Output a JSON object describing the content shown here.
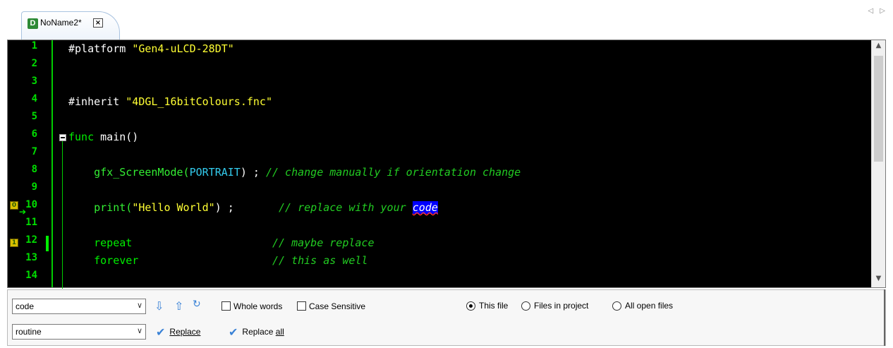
{
  "tab": {
    "icon_letter": "D",
    "title": "NoName2*",
    "close_glyph": "×",
    "scroll_glyphs": "◁ ▷"
  },
  "editor": {
    "lines": [
      {
        "num": "1",
        "parts": [
          [
            "pl",
            "#platform "
          ],
          [
            "str",
            "\"Gen4-uLCD-28DT\""
          ]
        ]
      },
      {
        "num": "2",
        "parts": []
      },
      {
        "num": "3",
        "parts": []
      },
      {
        "num": "4",
        "parts": [
          [
            "pl",
            "#inherit "
          ],
          [
            "str",
            "\"4DGL_16bitColours.fnc\""
          ]
        ]
      },
      {
        "num": "5",
        "parts": []
      },
      {
        "num": "6",
        "parts": [
          [
            "kw",
            "func "
          ],
          [
            "pl",
            "main()"
          ]
        ]
      },
      {
        "num": "7",
        "parts": []
      },
      {
        "num": "8",
        "parts": [
          [
            "fn",
            "    gfx_ScreenMode("
          ],
          [
            "cst",
            "PORTRAIT"
          ],
          [
            "pl",
            ") ; "
          ],
          [
            "cmt",
            "// change manually if orientation change"
          ]
        ]
      },
      {
        "num": "9",
        "parts": []
      },
      {
        "num": "10",
        "parts": [
          [
            "fn",
            "    print("
          ],
          [
            "str",
            "\"Hello World\""
          ],
          [
            "pl",
            ") ;       "
          ],
          [
            "cmt",
            "// replace with your "
          ],
          [
            "hl",
            "code"
          ]
        ]
      },
      {
        "num": "11",
        "parts": []
      },
      {
        "num": "12",
        "parts": [
          [
            "kw",
            "    repeat                      "
          ],
          [
            "cmt",
            "// maybe replace"
          ]
        ]
      },
      {
        "num": "13",
        "parts": [
          [
            "kw",
            "    forever                     "
          ],
          [
            "cmt",
            "// this as well"
          ]
        ]
      },
      {
        "num": "14",
        "parts": []
      }
    ],
    "bookmark_10": "0",
    "bookmark_12": "1",
    "arrow_glyph": "➔",
    "scroll_up": "▲",
    "scroll_down": "▼"
  },
  "find": {
    "search_value": "code",
    "replace_value": "routine",
    "dropdown_glyph": "∨",
    "next_glyph": "⇩",
    "prev_glyph": "⇧",
    "refresh_glyph": "↻",
    "whole_words": "Whole words",
    "case_sensitive": "Case Sensitive",
    "scope_this_file": "This file",
    "scope_project": "Files in project",
    "scope_open": "All open files",
    "replace_label": "Replace",
    "replace_all_label_prefix": "Replace ",
    "replace_all_label_underlined": "all",
    "replace_icon": "✔"
  },
  "colors": {
    "line_number": "#00dd00",
    "keyword": "#00ee00",
    "string": "#ffff33",
    "comment": "#22cc22",
    "constant": "#33ccee",
    "highlight": "#0000ff"
  }
}
